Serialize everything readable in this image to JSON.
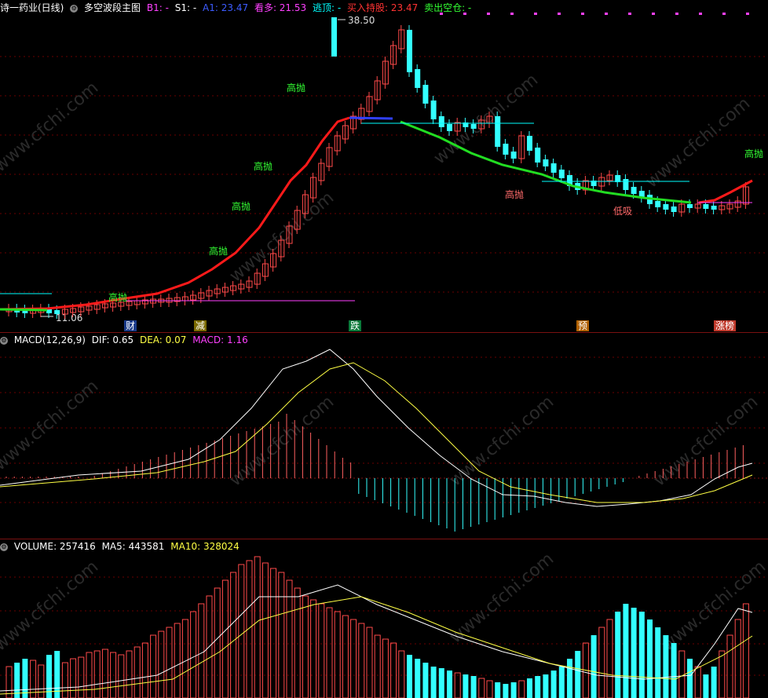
{
  "main": {
    "stock_name": "诗一药业(日线)",
    "indicator_name": "多空波段主图",
    "items": [
      {
        "label": "B1: -",
        "color": "#ff40ff"
      },
      {
        "label": "S1: -",
        "color": "#ffffff"
      },
      {
        "label": "A1: 23.47",
        "color": "#3d5cff"
      },
      {
        "label": "看多: 21.53",
        "color": "#ff40ff"
      },
      {
        "label": "逃顶: -",
        "color": "#00ffff"
      },
      {
        "label": "买入持股: 23.47",
        "color": "#ff3333"
      },
      {
        "label": "卖出空仓: -",
        "color": "#33ff33"
      }
    ],
    "high_label": "38.50",
    "low_label": "11.06",
    "signals": [
      "高抛",
      "高抛",
      "高抛",
      "高抛",
      "高抛",
      "高抛",
      "高抛",
      "低吸",
      "低吸"
    ],
    "events": [
      "财",
      "减",
      "跌",
      "预",
      "涨榜"
    ]
  },
  "macd": {
    "title": "MACD(12,26,9)",
    "dif": "DIF: 0.65",
    "dea": "DEA: 0.07",
    "macd": "MACD: 1.16"
  },
  "volume": {
    "title": "VOLUME: 257416",
    "ma5": "MA5: 443581",
    "ma10": "MA10: 328024"
  },
  "watermark": "www.cfchi.com",
  "colors": {
    "up": "#ff4a4a",
    "down": "#33ffff",
    "ma_up": "#ff1a1a",
    "ma_down": "#22dd22",
    "grid": "#6a0000"
  }
}
